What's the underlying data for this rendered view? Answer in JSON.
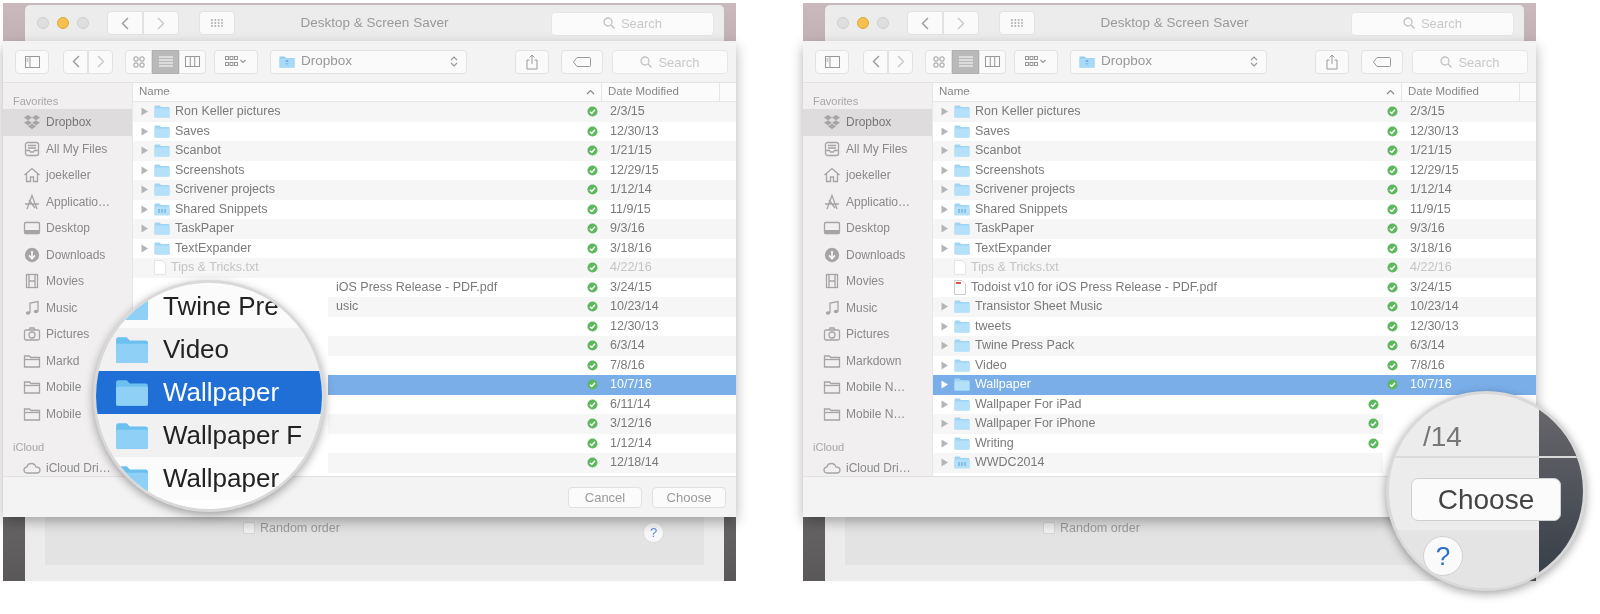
{
  "panels": [
    {
      "window": {
        "title": "Desktop & Screen Saver",
        "search_placeholder": "Search"
      },
      "dialog": {
        "location": "Dropbox",
        "search_placeholder": "Search",
        "view_modes": [
          {
            "kind": "icons",
            "selected": false
          },
          {
            "kind": "list",
            "selected": true
          },
          {
            "kind": "columns",
            "selected": false
          }
        ],
        "sidebar": [
          {
            "heading": "Favorites",
            "items": [
              {
                "kind": "dropbox",
                "label": "Dropbox",
                "selected": true
              },
              {
                "kind": "files",
                "label": "All My Files",
                "selected": false
              },
              {
                "kind": "home",
                "label": "joekeller",
                "selected": false
              },
              {
                "kind": "apps",
                "label": "Applicatio…",
                "selected": false
              },
              {
                "kind": "desktop",
                "label": "Desktop",
                "selected": false
              },
              {
                "kind": "downloads",
                "label": "Downloads",
                "selected": false
              },
              {
                "kind": "movies",
                "label": "Movies",
                "selected": false
              },
              {
                "kind": "music",
                "label": "Music",
                "selected": false
              },
              {
                "kind": "pictures",
                "label": "Pictures",
                "selected": false
              },
              {
                "kind": "folder",
                "label": "Markd",
                "selected": false
              },
              {
                "kind": "folder",
                "label": "Mobile",
                "selected": false
              },
              {
                "kind": "folder",
                "label": "Mobile",
                "selected": false
              }
            ]
          },
          {
            "heading": "iCloud",
            "items": [
              {
                "kind": "cloud",
                "label": "iCloud Dri…",
                "selected": false
              }
            ]
          }
        ],
        "columns": [
          "Name",
          "Date Modified"
        ],
        "rows": [
          {
            "kind": "folder",
            "name": "Ron Keller pictures",
            "synced": true,
            "date": "2/3/15",
            "selected": false,
            "dimmed": false,
            "covered": false
          },
          {
            "kind": "folder",
            "name": "Saves",
            "synced": true,
            "date": "12/30/13",
            "selected": false,
            "dimmed": false,
            "covered": false
          },
          {
            "kind": "folder",
            "name": "Scanbot",
            "synced": true,
            "date": "1/21/15",
            "selected": false,
            "dimmed": false,
            "covered": false
          },
          {
            "kind": "folder",
            "name": "Screenshots",
            "synced": true,
            "date": "12/29/15",
            "selected": false,
            "dimmed": false,
            "covered": false
          },
          {
            "kind": "folder",
            "name": "Scrivener projects",
            "synced": true,
            "date": "1/12/14",
            "selected": false,
            "dimmed": false,
            "covered": false
          },
          {
            "kind": "shared-folder",
            "name": "Shared Snippets",
            "synced": true,
            "date": "11/9/15",
            "selected": false,
            "dimmed": false,
            "covered": false
          },
          {
            "kind": "folder",
            "name": "TaskPaper",
            "synced": true,
            "date": "9/3/16",
            "selected": false,
            "dimmed": false,
            "covered": false
          },
          {
            "kind": "folder",
            "name": "TextExpander",
            "synced": true,
            "date": "3/18/16",
            "selected": false,
            "dimmed": false,
            "covered": false
          },
          {
            "kind": "text",
            "name": "Tips & Tricks.txt",
            "synced": true,
            "date": "4/22/16",
            "selected": false,
            "dimmed": true,
            "covered": false
          },
          {
            "name": "iOS Press Release - PDF.pdf",
            "synced": true,
            "date": "3/24/15",
            "selected": false,
            "dimmed": false,
            "covered": true
          },
          {
            "name": "usic",
            "synced": true,
            "date": "10/23/14",
            "selected": false,
            "dimmed": false,
            "covered": true
          },
          {
            "synced": true,
            "date": "12/30/13",
            "selected": false,
            "dimmed": false,
            "covered": true
          },
          {
            "synced": true,
            "date": "6/3/14",
            "selected": false,
            "dimmed": false,
            "covered": true
          },
          {
            "synced": true,
            "date": "7/8/16",
            "selected": false,
            "dimmed": false,
            "covered": true
          },
          {
            "synced": true,
            "date": "10/7/16",
            "selected": true,
            "dimmed": false,
            "covered": true
          },
          {
            "synced": true,
            "date": "6/11/14",
            "selected": false,
            "dimmed": false,
            "covered": true
          },
          {
            "synced": true,
            "date": "3/12/16",
            "selected": false,
            "dimmed": false,
            "covered": true
          },
          {
            "synced": true,
            "date": "1/12/14",
            "selected": false,
            "dimmed": false,
            "covered": true
          },
          {
            "synced": true,
            "date": "12/18/14",
            "selected": false,
            "dimmed": false,
            "covered": true
          }
        ],
        "buttons": [
          "Cancel",
          "Choose"
        ]
      },
      "behind": {
        "checkbox": {
          "label": "Random order",
          "checked": false
        },
        "help": "?"
      },
      "magnifier": {
        "kind": "rows",
        "rows": [
          {
            "name": "Twine Pre",
            "selected": false
          },
          {
            "name": "Video",
            "selected": false
          },
          {
            "name": "Wallpaper",
            "selected": true
          },
          {
            "name": "Wallpaper F",
            "selected": false
          },
          {
            "name": "Wallpaper",
            "selected": false
          }
        ]
      }
    },
    {
      "window": {
        "title": "Desktop & Screen Saver",
        "search_placeholder": "Search"
      },
      "dialog": {
        "location": "Dropbox",
        "search_placeholder": "Search",
        "view_modes": [
          {
            "kind": "icons",
            "selected": false
          },
          {
            "kind": "list",
            "selected": true
          },
          {
            "kind": "columns",
            "selected": false
          }
        ],
        "sidebar": [
          {
            "heading": "Favorites",
            "items": [
              {
                "kind": "dropbox",
                "label": "Dropbox",
                "selected": true
              },
              {
                "kind": "files",
                "label": "All My Files",
                "selected": false
              },
              {
                "kind": "home",
                "label": "joekeller",
                "selected": false
              },
              {
                "kind": "apps",
                "label": "Applicatio…",
                "selected": false
              },
              {
                "kind": "desktop",
                "label": "Desktop",
                "selected": false
              },
              {
                "kind": "downloads",
                "label": "Downloads",
                "selected": false
              },
              {
                "kind": "movies",
                "label": "Movies",
                "selected": false
              },
              {
                "kind": "music",
                "label": "Music",
                "selected": false
              },
              {
                "kind": "pictures",
                "label": "Pictures",
                "selected": false
              },
              {
                "kind": "folder",
                "label": "Markdown",
                "selected": false
              },
              {
                "kind": "folder",
                "label": "Mobile N…",
                "selected": false
              },
              {
                "kind": "folder",
                "label": "Mobile N…",
                "selected": false
              }
            ]
          },
          {
            "heading": "iCloud",
            "items": [
              {
                "kind": "cloud",
                "label": "iCloud Dri…",
                "selected": false
              }
            ]
          }
        ],
        "columns": [
          "Name",
          "Date Modified"
        ],
        "rows": [
          {
            "kind": "folder",
            "name": "Ron Keller pictures",
            "synced": true,
            "date": "2/3/15",
            "selected": false,
            "dimmed": false,
            "covered": false
          },
          {
            "kind": "folder",
            "name": "Saves",
            "synced": true,
            "date": "12/30/13",
            "selected": false,
            "dimmed": false,
            "covered": false
          },
          {
            "kind": "folder",
            "name": "Scanbot",
            "synced": true,
            "date": "1/21/15",
            "selected": false,
            "dimmed": false,
            "covered": false
          },
          {
            "kind": "folder",
            "name": "Screenshots",
            "synced": true,
            "date": "12/29/15",
            "selected": false,
            "dimmed": false,
            "covered": false
          },
          {
            "kind": "folder",
            "name": "Scrivener projects",
            "synced": true,
            "date": "1/12/14",
            "selected": false,
            "dimmed": false,
            "covered": false
          },
          {
            "kind": "shared-folder",
            "name": "Shared Snippets",
            "synced": true,
            "date": "11/9/15",
            "selected": false,
            "dimmed": false,
            "covered": false
          },
          {
            "kind": "folder",
            "name": "TaskPaper",
            "synced": true,
            "date": "9/3/16",
            "selected": false,
            "dimmed": false,
            "covered": false
          },
          {
            "kind": "folder",
            "name": "TextExpander",
            "synced": true,
            "date": "3/18/16",
            "selected": false,
            "dimmed": false,
            "covered": false
          },
          {
            "kind": "text",
            "name": "Tips & Tricks.txt",
            "synced": true,
            "date": "4/22/16",
            "selected": false,
            "dimmed": true,
            "covered": false
          },
          {
            "kind": "pdf",
            "name": "Todoist v10 for iOS Press Release - PDF.pdf",
            "synced": true,
            "date": "3/24/15",
            "selected": false,
            "dimmed": false,
            "covered": false
          },
          {
            "kind": "folder",
            "name": "Transistor Sheet Music",
            "synced": true,
            "date": "10/23/14",
            "selected": false,
            "dimmed": false,
            "covered": false
          },
          {
            "kind": "folder",
            "name": "tweets",
            "synced": true,
            "date": "12/30/13",
            "selected": false,
            "dimmed": false,
            "covered": false
          },
          {
            "kind": "folder",
            "name": "Twine Press Pack",
            "synced": true,
            "date": "6/3/14",
            "selected": false,
            "dimmed": false,
            "covered": false
          },
          {
            "kind": "folder",
            "name": "Video",
            "synced": true,
            "date": "7/8/16",
            "selected": false,
            "dimmed": false,
            "covered": false
          },
          {
            "kind": "folder",
            "name": "Wallpaper",
            "synced": true,
            "date": "10/7/16",
            "selected": true,
            "dimmed": false,
            "covered": false
          },
          {
            "kind": "folder",
            "name": "Wallpaper For iPad",
            "synced": true,
            "selected": false,
            "dimmed": false,
            "covered": true
          },
          {
            "kind": "folder",
            "name": "Wallpaper For iPhone",
            "synced": true,
            "selected": false,
            "dimmed": false,
            "covered": true
          },
          {
            "kind": "folder",
            "name": "Writing",
            "synced": true,
            "selected": false,
            "dimmed": false,
            "covered": true
          },
          {
            "kind": "shared-folder",
            "name": "WWDC2014",
            "selected": false,
            "dimmed": false,
            "covered": true
          }
        ]
      },
      "behind": {
        "checkbox": {
          "label": "Random order",
          "checked": false
        }
      },
      "magnifier": {
        "kind": "footer",
        "text": "/14",
        "button": "Choose",
        "help": "?"
      }
    }
  ]
}
